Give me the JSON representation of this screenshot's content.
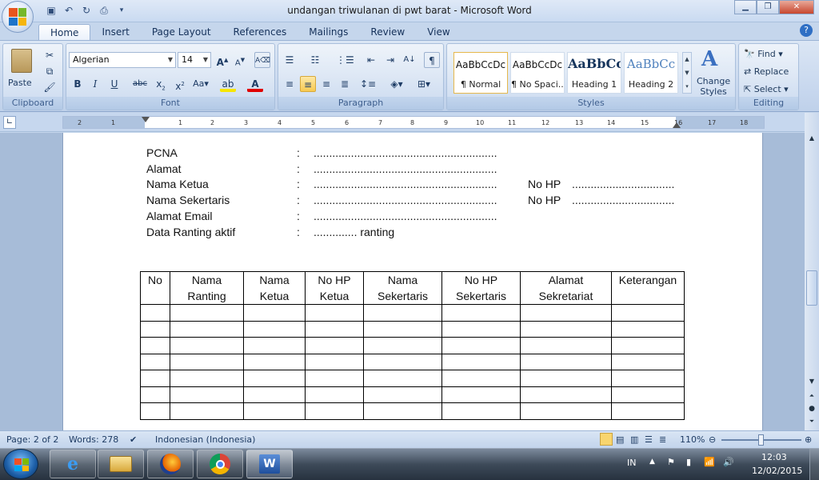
{
  "window": {
    "title": "undangan triwulanan di pwt barat - Microsoft Word"
  },
  "tabs": [
    "Home",
    "Insert",
    "Page Layout",
    "References",
    "Mailings",
    "Review",
    "View"
  ],
  "ribbon": {
    "clipboard": {
      "label": "Clipboard",
      "paste": "Paste"
    },
    "font": {
      "label": "Font",
      "name": "Algerian",
      "size": "14"
    },
    "paragraph": {
      "label": "Paragraph"
    },
    "styles": {
      "label": "Styles",
      "items": [
        {
          "preview": "AaBbCcDc",
          "name": "¶ Normal"
        },
        {
          "preview": "AaBbCcDc",
          "name": "¶ No Spaci..."
        },
        {
          "preview": "AaBbCc",
          "name": "Heading 1"
        },
        {
          "preview": "AaBbCc",
          "name": "Heading 2"
        }
      ],
      "change_styles_1": "Change",
      "change_styles_2": "Styles"
    },
    "editing": {
      "label": "Editing",
      "find": "Find",
      "replace": "Replace",
      "select": "Select"
    }
  },
  "ruler": {
    "ticks": [
      "2",
      "1",
      "1",
      "1",
      "2",
      "3",
      "4",
      "5",
      "6",
      "7",
      "8",
      "9",
      "10",
      "11",
      "12",
      "13",
      "14",
      "15",
      "16",
      "17",
      "18"
    ]
  },
  "document": {
    "fields": [
      {
        "label": "PCNA",
        "colon": ":",
        "dots": "...........................................................",
        "extra_label": "",
        "extra_dots": ""
      },
      {
        "label": "Alamat",
        "colon": ":",
        "dots": "...........................................................",
        "extra_label": "",
        "extra_dots": ""
      },
      {
        "label": "Nama Ketua",
        "colon": ":",
        "dots": "...........................................................",
        "extra_label": "No HP",
        "extra_dots": "................................."
      },
      {
        "label": "Nama Sekertaris",
        "colon": ":",
        "dots": "...........................................................",
        "extra_label": "No HP",
        "extra_dots": "................................."
      },
      {
        "label": "Alamat Email",
        "colon": ":",
        "dots": "...........................................................",
        "extra_label": "",
        "extra_dots": ""
      },
      {
        "label": "Data Ranting aktif",
        "colon": ":",
        "dots": ".............. ranting",
        "extra_label": "",
        "extra_dots": ""
      }
    ],
    "table": {
      "headers": [
        {
          "l1": "No",
          "l2": ""
        },
        {
          "l1": "Nama",
          "l2": "Ranting"
        },
        {
          "l1": "Nama",
          "l2": "Ketua"
        },
        {
          "l1": "No HP",
          "l2": "Ketua"
        },
        {
          "l1": "Nama",
          "l2": "Sekertaris"
        },
        {
          "l1": "No HP",
          "l2": "Sekertaris"
        },
        {
          "l1": "Alamat",
          "l2": "Sekretariat"
        },
        {
          "l1": "Keterangan",
          "l2": ""
        }
      ],
      "empty_rows": 7
    }
  },
  "status": {
    "page": "Page: 2 of 2",
    "words": "Words: 278",
    "language": "Indonesian (Indonesia)",
    "zoom": "110%"
  },
  "taskbar": {
    "lang": "IN",
    "time": "12:03",
    "date": "12/02/2015"
  }
}
